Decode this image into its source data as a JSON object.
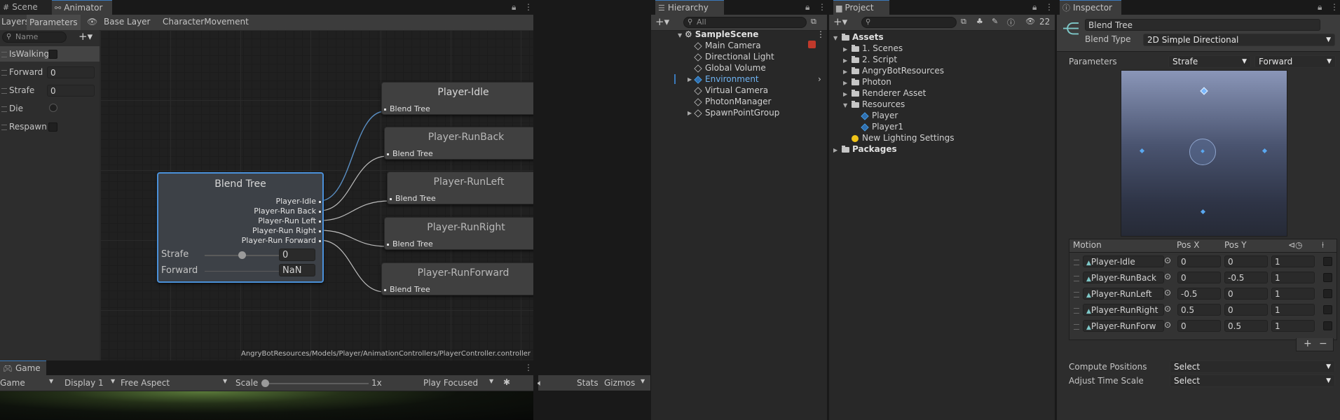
{
  "colors": {
    "accent": "#3a79bb",
    "node_selected_border": "#4a90d9",
    "link_blue": "#5aa8f0"
  },
  "scene_tab": "Scene",
  "animator": {
    "tab": "Animator",
    "layers_tab": "Layers",
    "parameters_tab": "Parameters",
    "breadcrumb": [
      "Base Layer",
      "CharacterMovement"
    ],
    "search_placeholder": "Name",
    "params": [
      {
        "name": "IsWalking",
        "type": "bool",
        "value": ""
      },
      {
        "name": "Forward",
        "type": "float",
        "value": "0"
      },
      {
        "name": "Strafe",
        "type": "float",
        "value": "0"
      },
      {
        "name": "Die",
        "type": "trigger",
        "value": ""
      },
      {
        "name": "Respawn",
        "type": "bool",
        "value": ""
      }
    ],
    "blend_tree": {
      "title": "Blend Tree",
      "outputs": [
        "Player-Idle",
        "Player-Run Back",
        "Player-Run Left",
        "Player-Run Right",
        "Player-Run Forward"
      ],
      "strafe_label": "Strafe",
      "strafe_value": "0",
      "forward_label": "Forward",
      "forward_value": "NaN"
    },
    "states": [
      {
        "title": "Player-Idle",
        "port": "Blend Tree"
      },
      {
        "title": "Player-RunBack",
        "port": "Blend Tree"
      },
      {
        "title": "Player-RunLeft",
        "port": "Blend Tree"
      },
      {
        "title": "Player-RunRight",
        "port": "Blend Tree"
      },
      {
        "title": "Player-RunForward",
        "port": "Blend Tree"
      }
    ],
    "path": "AngryBotResources/Models/Player/AnimationControllers/PlayerController.controller"
  },
  "game": {
    "tab": "Game",
    "mode": "Game",
    "display": "Display 1",
    "aspect": "Free Aspect",
    "scale_label": "Scale",
    "scale_value": "1x",
    "play_mode": "Play Focused",
    "stats": "Stats",
    "gizmos": "Gizmos"
  },
  "hierarchy": {
    "tab": "Hierarchy",
    "search_placeholder": "All",
    "scene": "SampleScene",
    "items": [
      "Main Camera",
      "Directional Light",
      "Global Volume",
      "Environment",
      "Virtual Camera",
      "PhotonManager",
      "SpawnPointGroup"
    ]
  },
  "project": {
    "tab": "Project",
    "hidden_count": "22",
    "assets": "Assets",
    "folders": [
      "1. Scenes",
      "2. Script",
      "AngryBotResources",
      "Photon",
      "Renderer Asset",
      "Resources"
    ],
    "resources_children": [
      "Player",
      "Player1"
    ],
    "lighting": "New Lighting Settings",
    "packages": "Packages"
  },
  "inspector": {
    "tab": "Inspector",
    "name": "Blend Tree",
    "blend_type_label": "Blend Type",
    "blend_type": "2D Simple Directional",
    "parameters_label": "Parameters",
    "param_x": "Strafe",
    "param_y": "Forward",
    "motion_header": {
      "motion": "Motion",
      "posx": "Pos X",
      "posy": "Pos Y"
    },
    "motions": [
      {
        "name": "Player-Idle",
        "x": "0",
        "y": "0",
        "speed": "1"
      },
      {
        "name": "Player-RunBack",
        "x": "0",
        "y": "-0.5",
        "speed": "1"
      },
      {
        "name": "Player-RunLeft",
        "x": "-0.5",
        "y": "0",
        "speed": "1"
      },
      {
        "name": "Player-RunRight",
        "x": "0.5",
        "y": "0",
        "speed": "1"
      },
      {
        "name": "Player-RunForw",
        "x": "0",
        "y": "0.5",
        "speed": "1"
      }
    ],
    "compute_positions_label": "Compute Positions",
    "compute_positions": "Select",
    "adjust_time_label": "Adjust Time Scale",
    "adjust_time": "Select"
  }
}
